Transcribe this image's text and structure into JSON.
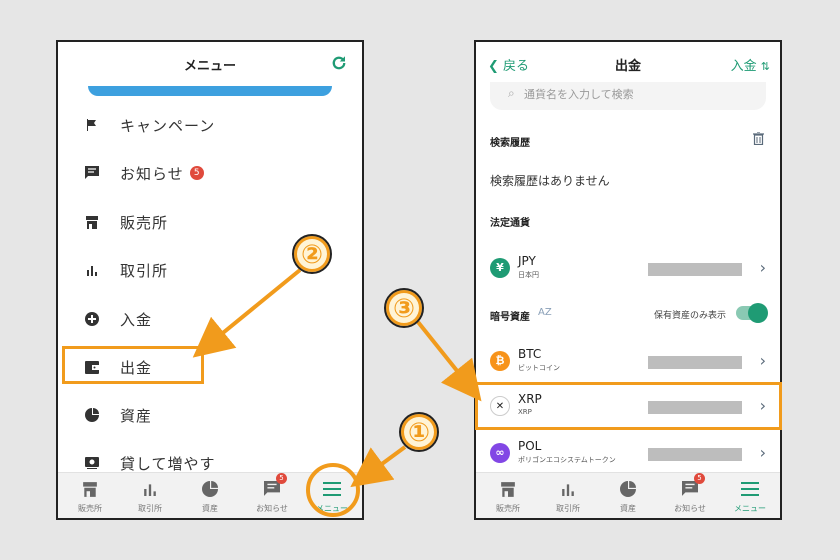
{
  "left": {
    "title": "メニュー",
    "menu": [
      {
        "label": "キャンペーン",
        "icon": "flag-icon"
      },
      {
        "label": "お知らせ",
        "icon": "message-icon",
        "badge": "5"
      },
      {
        "label": "販売所",
        "icon": "store-icon"
      },
      {
        "label": "取引所",
        "icon": "bar-chart-icon"
      },
      {
        "label": "入金",
        "icon": "plus-circle-icon"
      },
      {
        "label": "出金",
        "icon": "wallet-icon"
      },
      {
        "label": "資産",
        "icon": "pie-chart-icon"
      },
      {
        "label": "貸して増やす",
        "icon": "lend-icon"
      }
    ]
  },
  "tabs": [
    {
      "label": "販売所",
      "icon": "store-icon"
    },
    {
      "label": "取引所",
      "icon": "bar-chart-icon"
    },
    {
      "label": "資産",
      "icon": "pie-chart-icon"
    },
    {
      "label": "お知らせ",
      "icon": "message-icon",
      "badge": "5"
    },
    {
      "label": "メニュー",
      "icon": "menu-icon"
    }
  ],
  "right": {
    "back_label": "戻る",
    "title": "出金",
    "deposit_label": "入金",
    "search_placeholder": "通貨名を入力して検索",
    "history_header": "検索履歴",
    "history_empty": "検索履歴はありません",
    "fiat_header": "法定通貨",
    "crypto_header": "暗号資産",
    "sort_label": "AZ",
    "owned_only_label": "保有資産のみ表示",
    "coins": [
      {
        "symbol": "JPY",
        "name": "日本円",
        "icon_char": "¥",
        "color": "#1f9b74"
      },
      {
        "symbol": "BTC",
        "name": "ビットコイン",
        "icon_char": "₿",
        "color": "#f7931a"
      },
      {
        "symbol": "XRP",
        "name": "XRP",
        "icon_char": "✕",
        "color": "#222222"
      },
      {
        "symbol": "POL",
        "name": "ポリゴンエコシステムトークン",
        "icon_char": "∞",
        "color": "#8247e5"
      }
    ]
  },
  "annotations": [
    "①",
    "②",
    "③"
  ],
  "colors": {
    "accent": "#f19b1c",
    "brand": "#1f9b74",
    "badge": "#e04a3c"
  }
}
